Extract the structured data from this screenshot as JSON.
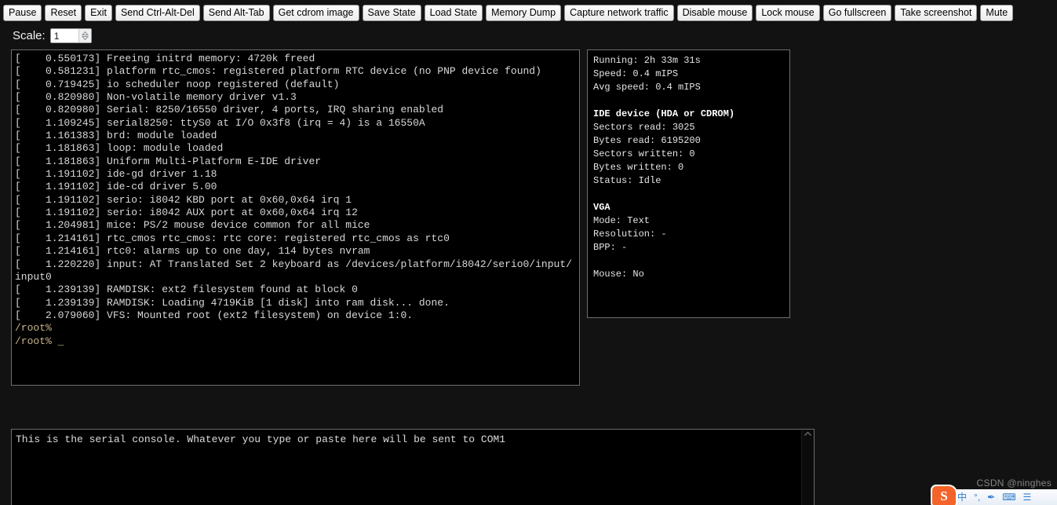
{
  "toolbar": {
    "buttons": [
      {
        "label": "Pause",
        "name": "pause-button"
      },
      {
        "label": "Reset",
        "name": "reset-button"
      },
      {
        "label": "Exit",
        "name": "exit-button"
      },
      {
        "label": "Send Ctrl-Alt-Del",
        "name": "send-ctrl-alt-del-button"
      },
      {
        "label": "Send Alt-Tab",
        "name": "send-alt-tab-button"
      },
      {
        "label": "Get cdrom image",
        "name": "get-cdrom-image-button"
      },
      {
        "label": "Save State",
        "name": "save-state-button"
      },
      {
        "label": "Load State",
        "name": "load-state-button"
      },
      {
        "label": "Memory Dump",
        "name": "memory-dump-button"
      },
      {
        "label": "Capture network traffic",
        "name": "capture-network-traffic-button"
      },
      {
        "label": "Disable mouse",
        "name": "disable-mouse-button"
      },
      {
        "label": "Lock mouse",
        "name": "lock-mouse-button"
      },
      {
        "label": "Go fullscreen",
        "name": "go-fullscreen-button"
      },
      {
        "label": "Take screenshot",
        "name": "take-screenshot-button"
      },
      {
        "label": "Mute",
        "name": "mute-button"
      }
    ]
  },
  "scale": {
    "label": "Scale:",
    "value": "1"
  },
  "vm_console": {
    "text": "[    0.550173] Freeing initrd memory: 4720k freed\n[    0.581231] platform rtc_cmos: registered platform RTC device (no PNP device found)\n[    0.719425] io scheduler noop registered (default)\n[    0.820980] Non-volatile memory driver v1.3\n[    0.820980] Serial: 8250/16550 driver, 4 ports, IRQ sharing enabled\n[    1.109245] serial8250: ttyS0 at I/O 0x3f8 (irq = 4) is a 16550A\n[    1.161383] brd: module loaded\n[    1.181863] loop: module loaded\n[    1.181863] Uniform Multi-Platform E-IDE driver\n[    1.191102] ide-gd driver 1.18\n[    1.191102] ide-cd driver 5.00\n[    1.191102] serio: i8042 KBD port at 0x60,0x64 irq 1\n[    1.191102] serio: i8042 AUX port at 0x60,0x64 irq 12\n[    1.204981] mice: PS/2 mouse device common for all mice\n[    1.214161] rtc_cmos rtc_cmos: rtc core: registered rtc_cmos as rtc0\n[    1.214161] rtc0: alarms up to one day, 114 bytes nvram\n[    1.220220] input: AT Translated Set 2 keyboard as /devices/platform/i8042/serio0/input/input0\n[    1.239139] RAMDISK: ext2 filesystem found at block 0\n[    1.239139] RAMDISK: Loading 4719KiB [1 disk] into ram disk... done.\n[    2.079060] VFS: Mounted root (ext2 filesystem) on device 1:0.\n",
    "prompt_1": "/root%",
    "prompt_2": "/root% _"
  },
  "info_panel": {
    "running": "Running: 2h 33m 31s",
    "speed": "Speed: 0.4 mIPS",
    "avg_speed": "Avg speed: 0.4 mIPS",
    "ide_heading": "IDE device (HDA or CDROM)",
    "sectors_read": "Sectors read: 3025",
    "bytes_read": "Bytes read: 6195200",
    "sectors_written": "Sectors written: 0",
    "bytes_written": "Bytes written: 0",
    "status": "Status: Idle",
    "vga_heading": "VGA",
    "vga_mode": "Mode: Text",
    "vga_resolution": "Resolution: -",
    "vga_bpp": "BPP: -",
    "mouse": "Mouse: No"
  },
  "serial_console": {
    "banner": "This is the serial console. Whatever you type or paste here will be sent to COM1",
    "value": ""
  },
  "watermark": {
    "text": "CSDN @ninghes"
  },
  "ime": {
    "logo": "S",
    "icons": [
      "chinese-mode-icon",
      "punctuation-icon",
      "pen-icon",
      "keyboard-icon",
      "toolbox-icon"
    ]
  }
}
